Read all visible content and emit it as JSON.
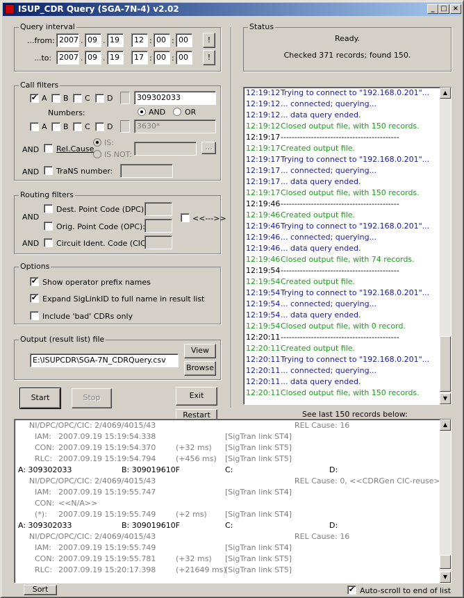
{
  "window": {
    "title": "ISUP_CDR Query  (SGA-7N-4)  v2.02",
    "min": "_",
    "max": "□",
    "close": "×"
  },
  "query": {
    "label": "Query interval",
    "from_label": "...from:",
    "to_label": "...to:",
    "from": {
      "year": "2007",
      "month": "09",
      "day": "19",
      "hour": "12",
      "min": "00",
      "sec": "00"
    },
    "to": {
      "year": "2007",
      "month": "09",
      "day": "19",
      "hour": "17",
      "min": "00",
      "sec": "00"
    },
    "dot": ".",
    "colon": ":",
    "bang": "!"
  },
  "call": {
    "label": "Call filters",
    "a": "A",
    "b": "B",
    "c": "C",
    "d": "D",
    "number1": "309302033",
    "numbers_label": "Numbers:",
    "and": "AND",
    "or": "OR",
    "number2": "3630*",
    "and_label": "AND",
    "relcause": "Rel.Cause",
    "is": "IS:",
    "isnot": "IS NOT:",
    "dots": "...",
    "trans": "TraNS number:"
  },
  "routing": {
    "label": "Routing filters",
    "and": "AND",
    "dpc": "Dest. Point Code (DPC):",
    "opc": "Orig. Point Code (OPC):",
    "cic": "Circuit Ident. Code (CIC):",
    "swap": "<<--->>"
  },
  "options": {
    "label": "Options",
    "o1": "Show operator prefix names",
    "o2": "Expand SigLinkID to full name in result list",
    "o3": "Include 'bad' CDRs only"
  },
  "output": {
    "label": "Output (result list) file",
    "path": "E:\\ISUPCDR\\SGA-7N_CDRQuery.csv",
    "view": "View",
    "browse": "Browse"
  },
  "buttons": {
    "start": "Start",
    "stop": "Stop",
    "exit": "Exit",
    "restart": "Restart",
    "sort": "Sort"
  },
  "status": {
    "label": "Status",
    "line1": "Ready.",
    "line2": "Checked 371 records; found 150."
  },
  "log": [
    {
      "t": "12:19:12",
      "m": "Trying to connect to \"192.168.0.201\"...",
      "c": "blue"
    },
    {
      "t": "12:19:12",
      "m": "... connected; querying...",
      "c": "blue"
    },
    {
      "t": "12:19:12",
      "m": "... data query ended.",
      "c": "blue"
    },
    {
      "t": "12:19:12",
      "m": "Closed output file, with 150 records.",
      "c": "green"
    },
    {
      "t": "12:19:17",
      "m": "-------------------------------------------",
      "c": "blk"
    },
    {
      "t": "12:19:17",
      "m": "Created output file.",
      "c": "green"
    },
    {
      "t": "12:19:17",
      "m": "Trying to connect to \"192.168.0.201\"...",
      "c": "blue"
    },
    {
      "t": "12:19:17",
      "m": "... connected; querying...",
      "c": "blue"
    },
    {
      "t": "12:19:17",
      "m": "... data query ended.",
      "c": "blue"
    },
    {
      "t": "12:19:17",
      "m": "Closed output file, with 150 records.",
      "c": "green"
    },
    {
      "t": "12:19:46",
      "m": "-------------------------------------------",
      "c": "blk"
    },
    {
      "t": "12:19:46",
      "m": "Created output file.",
      "c": "green"
    },
    {
      "t": "12:19:46",
      "m": "Trying to connect to \"192.168.0.201\"...",
      "c": "blue"
    },
    {
      "t": "12:19:46",
      "m": "... connected; querying...",
      "c": "blue"
    },
    {
      "t": "12:19:46",
      "m": "... data query ended.",
      "c": "blue"
    },
    {
      "t": "12:19:46",
      "m": "Closed output file, with 74 records.",
      "c": "green"
    },
    {
      "t": "12:19:54",
      "m": "-------------------------------------------",
      "c": "blk"
    },
    {
      "t": "12:19:54",
      "m": "Created output file.",
      "c": "green"
    },
    {
      "t": "12:19:54",
      "m": "Trying to connect to \"192.168.0.201\"...",
      "c": "blue"
    },
    {
      "t": "12:19:54",
      "m": "... connected; querying...",
      "c": "blue"
    },
    {
      "t": "12:19:54",
      "m": "... data query ended.",
      "c": "blue"
    },
    {
      "t": "12:19:54",
      "m": "Closed output file, with 0 record.",
      "c": "green"
    },
    {
      "t": "12:20:11",
      "m": "-------------------------------------------",
      "c": "blk"
    },
    {
      "t": "12:20:11",
      "m": "Created output file.",
      "c": "green"
    },
    {
      "t": "12:20:11",
      "m": "Trying to connect to \"192.168.0.201\"...",
      "c": "blue"
    },
    {
      "t": "12:20:11",
      "m": "... connected; querying...",
      "c": "blue"
    },
    {
      "t": "12:20:11",
      "m": "... data query ended.",
      "c": "blue"
    },
    {
      "t": "12:20:11",
      "m": "Closed output file, with 150 records.",
      "c": "green"
    }
  ],
  "see_last": "See last 150 records below:",
  "results": [
    {
      "k": "hdr",
      "a": "NI/DPC/OPC/CIC: 2/4069/4015/43",
      "b": "REL Cause: 16"
    },
    {
      "k": "ev",
      "n": "IAM:",
      "ts": "2007.09.19 15:19:54.338",
      "d": "",
      "l": "[SigTran link ST4]"
    },
    {
      "k": "ev",
      "n": "CON:",
      "ts": "2007.09.19 15:19:54.370",
      "d": "(+32 ms)",
      "l": "[SigTran link ST5]"
    },
    {
      "k": "ev",
      "n": "RLC:",
      "ts": "2007.09.19 15:19:54.794",
      "d": "(+456 ms)",
      "l": "[SigTran link ST5]"
    },
    {
      "k": "num",
      "a": "A:  309302033",
      "b": "B:  309019610F",
      "c": "C:",
      "d": "D:"
    },
    {
      "k": "hdr",
      "a": "NI/DPC/OPC/CIC: 2/4069/4015/43",
      "b": "REL Cause: 0,  <<CDRGen CIC-reuse>>"
    },
    {
      "k": "ev",
      "n": "IAM:",
      "ts": "2007.09.19 15:19:55.747",
      "d": "",
      "l": "[SigTran link ST4]"
    },
    {
      "k": "ev",
      "n": "CON:",
      "ts": "<<N/A>>",
      "d": "",
      "l": ""
    },
    {
      "k": "ev",
      "n": "(*):",
      "ts": "2007.09.19 15:19:55.749",
      "d": "(+2 ms)",
      "l": "[SigTran link ST4]"
    },
    {
      "k": "num",
      "a": "A:  309302033",
      "b": "B:  309019610F",
      "c": "C:",
      "d": "D:"
    },
    {
      "k": "hdr",
      "a": "NI/DPC/OPC/CIC: 2/4069/4015/43",
      "b": "REL Cause: 16"
    },
    {
      "k": "ev",
      "n": "IAM:",
      "ts": "2007.09.19 15:19:55.749",
      "d": "",
      "l": "[SigTran link ST4]"
    },
    {
      "k": "ev",
      "n": "CON:",
      "ts": "2007.09.19 15:19:55.781",
      "d": "(+32 ms)",
      "l": "[SigTran link ST5]"
    },
    {
      "k": "ev",
      "n": "RLC:",
      "ts": "2007.09.19 15:20:17.398",
      "d": "(+21649 ms)",
      "l": "[SigTran link ST5]"
    }
  ],
  "autoscroll": "Auto-scroll to end of list",
  "check": "✔",
  "arrows": {
    "up": "▲",
    "down": "▼"
  }
}
